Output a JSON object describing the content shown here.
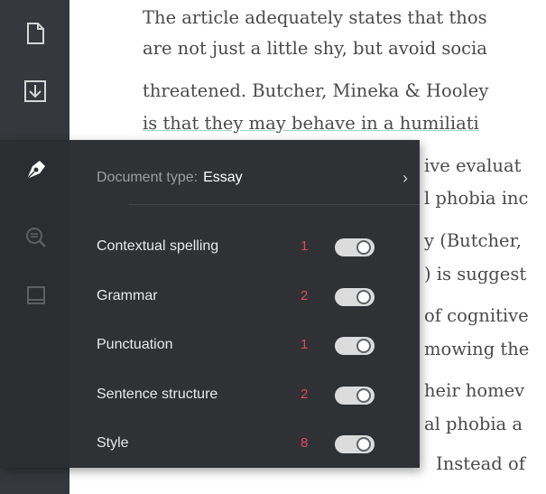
{
  "document": {
    "lines": [
      "The article adequately states that thos",
      "are not just a little shy, but avoid socia",
      "threatened. Butcher, Mineka & Hooley",
      "is that they may behave in a humiliati",
      "ive evaluat",
      "l phobia inc",
      "y (Butcher,",
      ") is suggest",
      "of cognitive",
      "mowing the",
      "heir homev",
      "al phobia a",
      "Instead of"
    ]
  },
  "sidebar": {
    "icons": [
      "document-icon",
      "download-icon"
    ],
    "panel_icons": [
      "pen-nib-icon",
      "search-magnify-icon",
      "book-icon"
    ]
  },
  "panel": {
    "document_type_label": "Document type:",
    "document_type_value": "Essay",
    "chevron": "›",
    "checks": [
      {
        "label": "Contextual spelling",
        "count": "1",
        "enabled": true
      },
      {
        "label": "Grammar",
        "count": "2",
        "enabled": true
      },
      {
        "label": "Punctuation",
        "count": "1",
        "enabled": true
      },
      {
        "label": "Sentence structure",
        "count": "2",
        "enabled": true
      },
      {
        "label": "Style",
        "count": "8",
        "enabled": true
      }
    ]
  },
  "colors": {
    "panel_bg": "#2f3135",
    "count_red": "#e2475a",
    "sidebar_bg": "#35383d"
  }
}
